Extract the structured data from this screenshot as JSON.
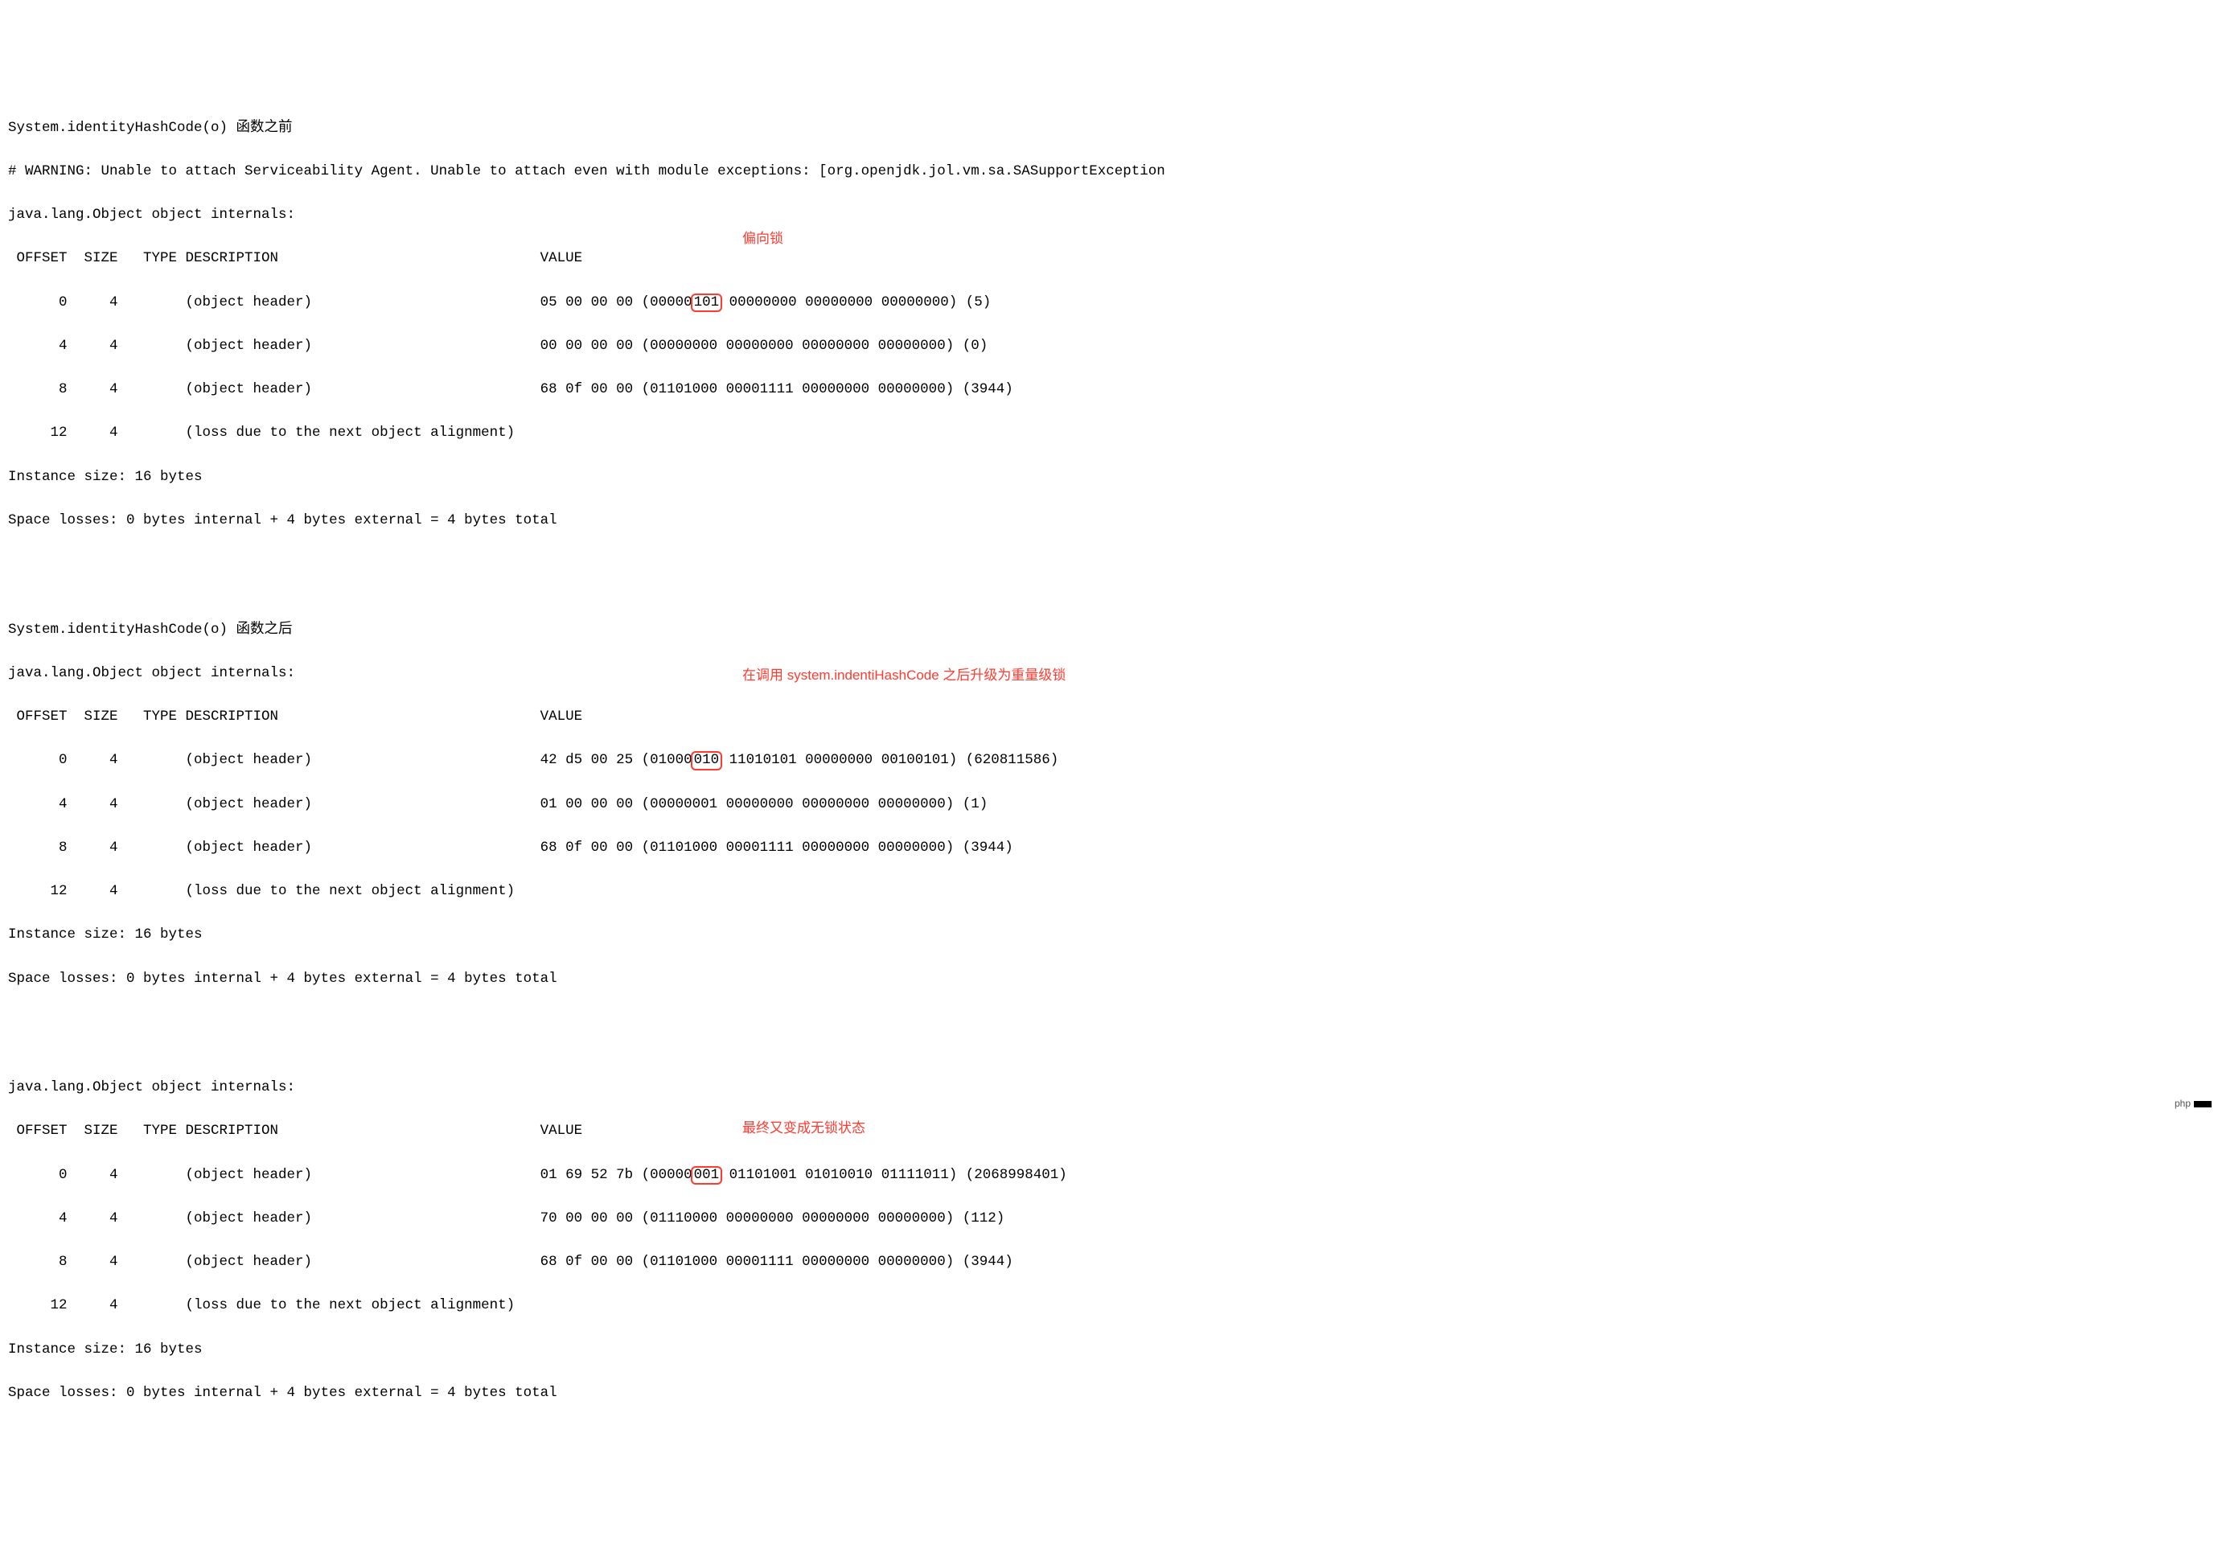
{
  "block1": {
    "title": "System.identityHashCode(o) 函数之前",
    "warning": "# WARNING: Unable to attach Serviceability Agent. Unable to attach even with module exceptions: [org.openjdk.jol.vm.sa.SASupportException",
    "internals": "java.lang.Object object internals:",
    "header": " OFFSET  SIZE   TYPE DESCRIPTION                               VALUE",
    "annotation": "偏向锁",
    "row0_left": "      0     4        (object header)                           05 00 00 00 (00000",
    "row0_box": "101",
    "row0_right": " 00000000 00000000 00000000) (5)",
    "row1": "      4     4        (object header)                           00 00 00 00 (00000000 00000000 00000000 00000000) (0)",
    "row2": "      8     4        (object header)                           68 0f 00 00 (01101000 00001111 00000000 00000000) (3944)",
    "row3": "     12     4        (loss due to the next object alignment)",
    "size": "Instance size: 16 bytes",
    "losses": "Space losses: 0 bytes internal + 4 bytes external = 4 bytes total"
  },
  "block2": {
    "title": "System.identityHashCode(o) 函数之后",
    "internals": "java.lang.Object object internals:",
    "annotation": "在调用 system.indentiHashCode 之后升级为重量级锁",
    "header": " OFFSET  SIZE   TYPE DESCRIPTION                               VALUE",
    "row0_left": "      0     4        (object header)                           42 d5 00 25 (01000",
    "row0_box": "010",
    "row0_right": " 11010101 00000000 00100101) (620811586)",
    "row1": "      4     4        (object header)                           01 00 00 00 (00000001 00000000 00000000 00000000) (1)",
    "row2": "      8     4        (object header)                           68 0f 00 00 (01101000 00001111 00000000 00000000) (3944)",
    "row3": "     12     4        (loss due to the next object alignment)",
    "size": "Instance size: 16 bytes",
    "losses": "Space losses: 0 bytes internal + 4 bytes external = 4 bytes total"
  },
  "block3": {
    "internals": "java.lang.Object object internals:",
    "annotation": "最终又变成无锁状态",
    "header": " OFFSET  SIZE   TYPE DESCRIPTION                               VALUE",
    "row0_left": "      0     4        (object header)                           01 69 52 7b (00000",
    "row0_box": "001",
    "row0_right": " 01101001 01010010 01111011) (2068998401)",
    "row1": "      4     4        (object header)                           70 00 00 00 (01110000 00000000 00000000 00000000) (112)",
    "row2": "      8     4        (object header)                           68 0f 00 00 (01101000 00001111 00000000 00000000) (3944)",
    "row3": "     12     4        (loss due to the next object alignment)",
    "size": "Instance size: 16 bytes",
    "losses": "Space losses: 0 bytes internal + 4 bytes external = 4 bytes total"
  },
  "watermark": "php"
}
